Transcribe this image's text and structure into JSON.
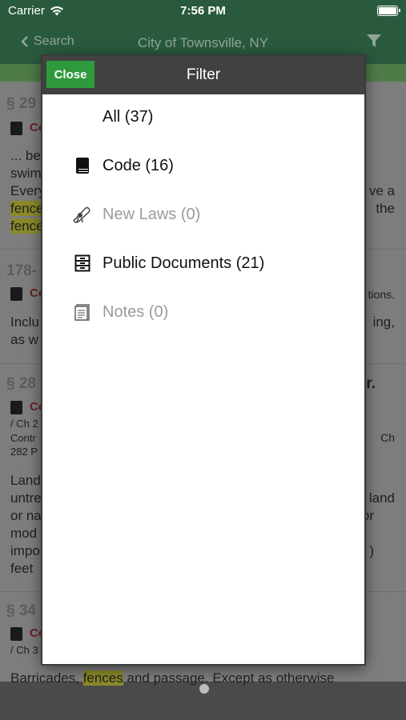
{
  "status_bar": {
    "carrier": "Carrier",
    "time": "7:56 PM"
  },
  "nav": {
    "back_label": "Search",
    "title": "City of Townsville, NY",
    "filter_icon": "filter-icon"
  },
  "background": {
    "items": [
      {
        "section": "§ 29",
        "type_label": "Co",
        "lines": [
          "... be",
          "swim",
          "Every"
        ],
        "right_lines": [
          "ve a",
          "the"
        ],
        "highlights": [
          "fence",
          "fence"
        ]
      },
      {
        "section": "178-",
        "type_label": "Co",
        "right_note": "tions.",
        "lines": [
          "Inclu",
          "as w"
        ],
        "right_lines": [
          "ing,"
        ]
      },
      {
        "section": "§ 28",
        "section_tail": "r.",
        "type_label": "Co",
        "small_lines": [
          "/ Ch 2",
          "Contr",
          "282 P"
        ],
        "small_right": "Ch",
        "lines": [
          "Land",
          "untre",
          "or na",
          "mod",
          "impo",
          "feet"
        ],
        "right_lines": [
          "land",
          "or",
          ")"
        ]
      },
      {
        "section": "§ 34",
        "type_label": "Co",
        "small_lines": [
          "/ Ch 3"
        ]
      }
    ],
    "bottom_text": {
      "before": "Barricades, ",
      "highlight": "fences",
      "after": " and passage. Except as otherwise"
    }
  },
  "modal": {
    "close_label": "Close",
    "title": "Filter",
    "items": [
      {
        "label": "All (37)",
        "icon": "none",
        "enabled": true
      },
      {
        "label": "Code (16)",
        "icon": "book-icon",
        "enabled": true
      },
      {
        "label": "New Laws (0)",
        "icon": "scroll-icon",
        "enabled": false
      },
      {
        "label": "Public Documents (21)",
        "icon": "file-cabinet-icon",
        "enabled": true
      },
      {
        "label": "Notes (0)",
        "icon": "note-icon",
        "enabled": false
      }
    ]
  }
}
